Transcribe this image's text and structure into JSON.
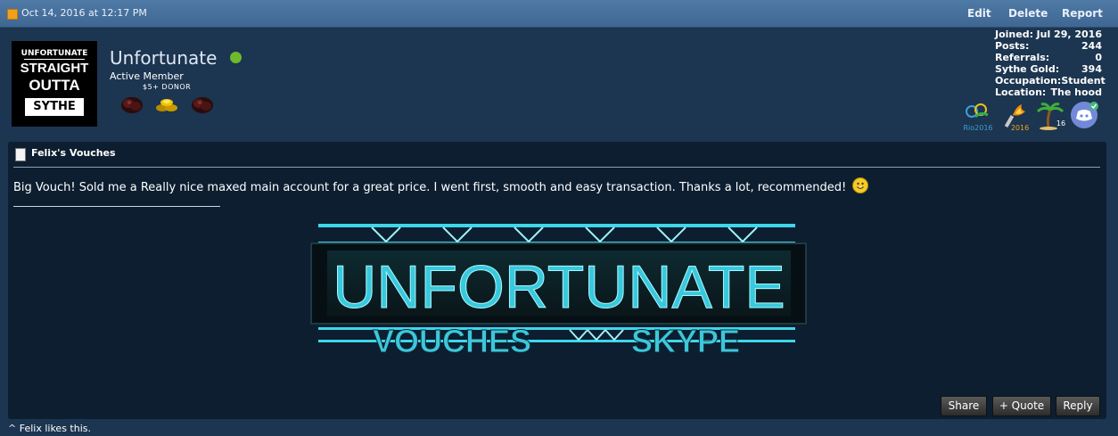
{
  "post": {
    "date": "Oct 14, 2016 at 12:17 PM",
    "actions": {
      "edit": "Edit",
      "delete": "Delete",
      "report": "Report"
    }
  },
  "user": {
    "name": "Unfortunate",
    "title": "Active Member",
    "donor": "$5+ DONOR",
    "avatar": {
      "small": "UNFORTUNATE",
      "line1": "STRAIGHT",
      "line2": "OUTTA",
      "box": "SYTHE"
    },
    "stats": [
      {
        "label": "Joined:",
        "value": "Jul 29, 2016"
      },
      {
        "label": "Posts:",
        "value": "244"
      },
      {
        "label": "Referrals:",
        "value": "0"
      },
      {
        "label": "Sythe Gold:",
        "value": "394"
      },
      {
        "label": "Occupation:",
        "value": "Student"
      },
      {
        "label": "Location:",
        "value": "The hood"
      }
    ],
    "trophies": {
      "rio": "Rio2016",
      "torch": "2016",
      "palm": "16"
    }
  },
  "content": {
    "title": "Felix's Vouches",
    "message": "Big Vouch! Sold me a Really nice maxed main account for a great price. I went first, smooth and easy transaction. Thanks a lot, recommended!",
    "banner": {
      "main": "UNFORTUNATE",
      "left": "VOUCHES",
      "right": "SKYPE"
    }
  },
  "buttons": {
    "share": "Share",
    "quote": "+ Quote",
    "reply": "Reply"
  },
  "likes": {
    "arrow": "^",
    "user": "Felix",
    "text": "likes this."
  },
  "colors": {
    "topbar": "#4f7aa6",
    "background": "#1c3550",
    "postbox": "#0c1e30",
    "online": "#6dba2d",
    "banner_glow": "#3fd6ea"
  }
}
